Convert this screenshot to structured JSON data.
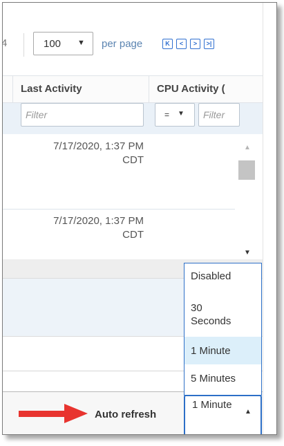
{
  "pager": {
    "count_fragment": "4",
    "page_size": "100",
    "per_page_label": "per page",
    "nav_buttons": [
      {
        "name": "first-page-icon",
        "glyph": "K"
      },
      {
        "name": "prev-page-icon",
        "glyph": "<"
      },
      {
        "name": "next-page-icon",
        "glyph": ">"
      },
      {
        "name": "last-page-icon",
        "glyph": ">|"
      }
    ]
  },
  "columns": [
    {
      "label": "Last Activity",
      "filter_placeholder": "Filter"
    },
    {
      "label": "CPU Activity (",
      "operator": "=",
      "filter_placeholder": "Filter"
    }
  ],
  "rows": [
    {
      "last_activity_line1": "7/17/2020, 1:37 PM",
      "last_activity_line2": "CDT"
    },
    {
      "last_activity_line1": "7/17/2020, 1:37 PM",
      "last_activity_line2": "CDT"
    }
  ],
  "footer": {
    "auto_refresh_label": "Auto refresh",
    "refresh_value": "1 Minute"
  },
  "refresh_options": [
    {
      "label": "Disabled",
      "selected": false
    },
    {
      "label": "30 Seconds",
      "selected": false
    },
    {
      "label": "1 Minute",
      "selected": true
    },
    {
      "label": "5 Minutes",
      "selected": false
    }
  ],
  "colors": {
    "accent": "#2c6fc7",
    "arrow": "#e8342f",
    "selected_option_bg": "#dceffa",
    "filter_row_bg": "#eaf1f8"
  }
}
